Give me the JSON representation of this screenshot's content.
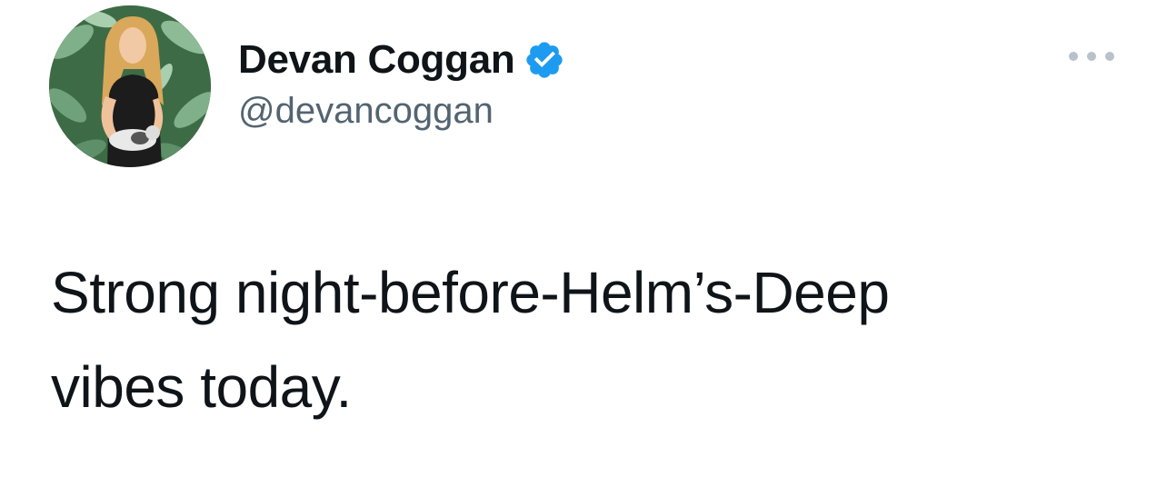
{
  "author": {
    "display_name": "Devan Coggan",
    "handle": "@devancoggan",
    "verified": true,
    "avatar_icon": "profile-photo"
  },
  "tweet": {
    "text_line1": "Strong night-before-Helm’s-Deep",
    "text_line2": "vibes today."
  },
  "menu": {
    "icon": "more-options-icon"
  },
  "colors": {
    "text": "#0f1419",
    "handle": "#536471",
    "verified_badge": "#1d9bf0",
    "more_dots": "#b9c2ca"
  }
}
